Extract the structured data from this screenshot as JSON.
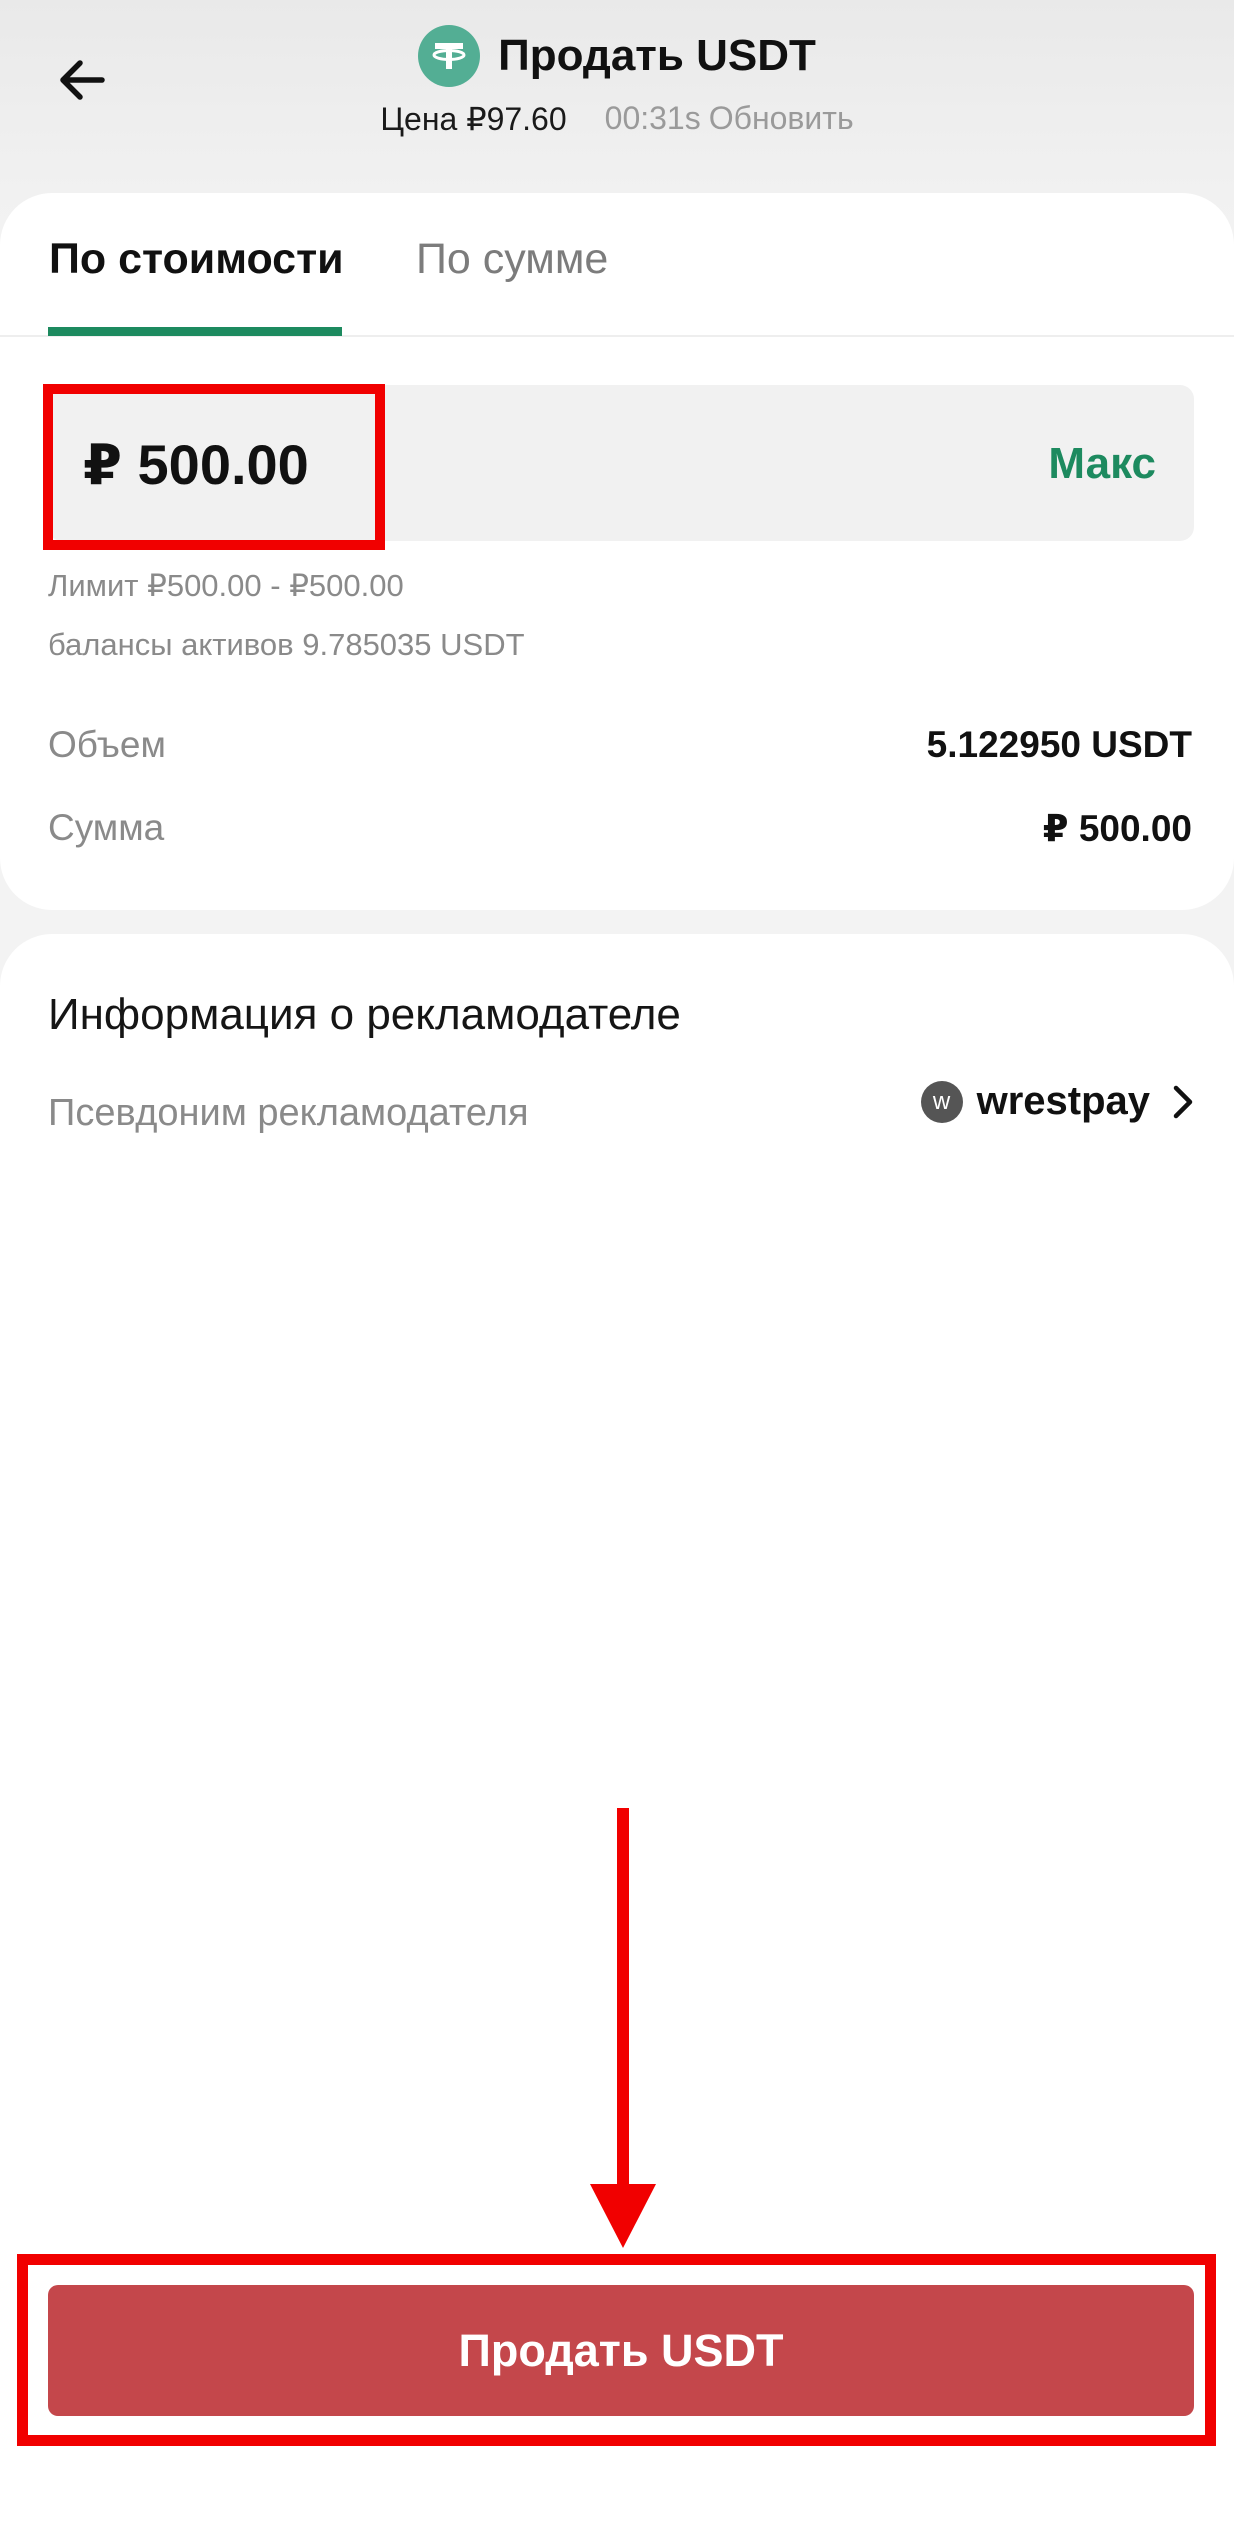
{
  "header": {
    "title": "Продать USDT",
    "price": "Цена ₽97.60",
    "timer": "00:31s",
    "refresh": "Обновить",
    "back_icon": "arrow-left-icon",
    "coin_icon": "usdt-logo-icon"
  },
  "tabs": [
    {
      "label": "По стоимости",
      "active": true
    },
    {
      "label": "По сумме",
      "active": false
    }
  ],
  "amount": {
    "value": "₽ 500.00",
    "max_label": "Макс"
  },
  "info": {
    "limit": "Лимит ₽500.00 - ₽500.00",
    "balance": "балансы активов 9.785035 USDT"
  },
  "rows": [
    {
      "label": "Объем",
      "value": "5.122950 USDT"
    },
    {
      "label": "Сумма",
      "value": "₽ 500.00"
    }
  ],
  "advertiser": {
    "section_title": "Информация о рекламодателе",
    "nickname_label": "Псевдоним рекламодателя",
    "avatar_letter": "w",
    "name": "wrestpay",
    "chevron_icon": "chevron-right-icon"
  },
  "button": {
    "label": "Продать USDT"
  },
  "colors": {
    "accent_green": "#1d8a5f",
    "usdt_green": "#53ae94",
    "sell_red": "#c4474b",
    "annotation_red": "#f10000"
  }
}
